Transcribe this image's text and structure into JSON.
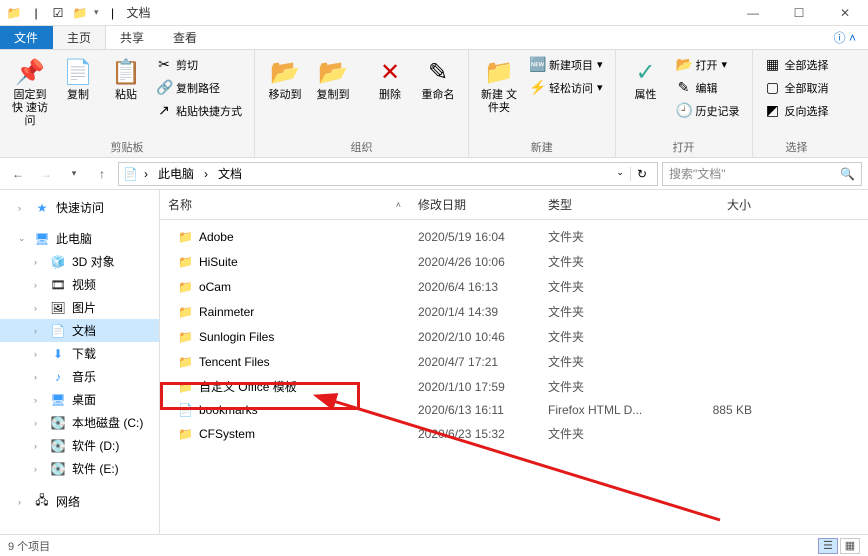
{
  "titlebar": {
    "title": "文档",
    "qat_back": "↩",
    "qat_check": "☑",
    "sep": "|"
  },
  "tabs": {
    "file": "文件",
    "home": "主页",
    "share": "共享",
    "view": "查看"
  },
  "ribbon": {
    "group1_label": "剪贴板",
    "pin_quick": "固定到快\n速访问",
    "copy": "复制",
    "paste": "粘贴",
    "cut": "剪切",
    "copy_path": "复制路径",
    "paste_shortcut": "粘贴快捷方式",
    "group2_label": "组织",
    "move_to": "移动到",
    "copy_to": "复制到",
    "delete": "删除",
    "rename": "重命名",
    "group3_label": "新建",
    "new_folder": "新建\n文件夹",
    "new_item": "新建项目",
    "easy_access": "轻松访问",
    "group4_label": "打开",
    "properties": "属性",
    "open": "打开",
    "edit": "编辑",
    "history": "历史记录",
    "group5_label": "选择",
    "select_all": "全部选择",
    "select_none": "全部取消",
    "invert_selection": "反向选择"
  },
  "address": {
    "this_pc": "此电脑",
    "docs": "文档",
    "refresh": "↻"
  },
  "search": {
    "placeholder": "搜索\"文档\""
  },
  "nav": {
    "quick_access": "快速访问",
    "this_pc": "此电脑",
    "objects3d": "3D 对象",
    "videos": "视频",
    "pictures": "图片",
    "documents": "文档",
    "downloads": "下载",
    "music": "音乐",
    "desktop": "桌面",
    "disk_c": "本地磁盘 (C:)",
    "disk_d": "软件 (D:)",
    "disk_e": "软件 (E:)",
    "network": "网络"
  },
  "columns": {
    "name": "名称",
    "date": "修改日期",
    "type": "类型",
    "size": "大小"
  },
  "types": {
    "folder": "文件夹",
    "firefox_html": "Firefox HTML D..."
  },
  "rows": [
    {
      "icon": "folder",
      "name": "Adobe",
      "date": "2020/5/19 16:04",
      "type_key": "folder",
      "size": ""
    },
    {
      "icon": "folder",
      "name": "HiSuite",
      "date": "2020/4/26 10:06",
      "type_key": "folder",
      "size": ""
    },
    {
      "icon": "folder",
      "name": "oCam",
      "date": "2020/6/4 16:13",
      "type_key": "folder",
      "size": ""
    },
    {
      "icon": "folder",
      "name": "Rainmeter",
      "date": "2020/1/4 14:39",
      "type_key": "folder",
      "size": ""
    },
    {
      "icon": "folder",
      "name": "Sunlogin Files",
      "date": "2020/2/10 10:46",
      "type_key": "folder",
      "size": ""
    },
    {
      "icon": "folder",
      "name": "Tencent Files",
      "date": "2020/4/7 17:21",
      "type_key": "folder",
      "size": ""
    },
    {
      "icon": "folder",
      "name": "自定义 Office 模板",
      "date": "2020/1/10 17:59",
      "type_key": "folder",
      "size": ""
    },
    {
      "icon": "file",
      "name": "bookmarks",
      "date": "2020/6/13 16:11",
      "type_key": "firefox_html",
      "size": "885 KB"
    },
    {
      "icon": "folder",
      "name": "CFSystem",
      "date": "2020/6/23 15:32",
      "type_key": "folder",
      "size": ""
    }
  ],
  "status": {
    "item_count": "9 个项目"
  }
}
